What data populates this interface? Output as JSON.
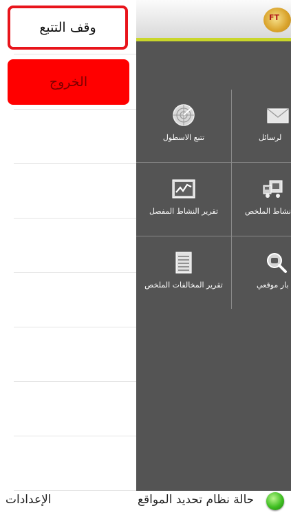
{
  "drawer": {
    "stop_tracking_label": "وقف التتبع",
    "exit_label": "الخروج"
  },
  "menu": {
    "tiles": [
      {
        "label": "تتبع الاسطول",
        "icon": "radar-icon"
      },
      {
        "label": "لرسائل",
        "icon": "envelope-icon"
      },
      {
        "label": "تقرير النشاط المفصل",
        "icon": "line-chart-icon"
      },
      {
        "label": "نشاط الملخص",
        "icon": "truck-icon"
      },
      {
        "label": "تقرير المخالفات الملخص",
        "icon": "document-list-icon"
      },
      {
        "label": "بار موقعي",
        "icon": "magnify-vehicle-icon"
      }
    ]
  },
  "footer": {
    "settings_label": "الإعدادات",
    "gps_status_label": "حالة نظام تحديد المواقع"
  },
  "colors": {
    "panel_bg": "#545454",
    "accent_bar": "#c9d62a",
    "exit_button": "#ff0000",
    "stop_border": "#e8141b",
    "status_ok": "#3fbf22"
  }
}
